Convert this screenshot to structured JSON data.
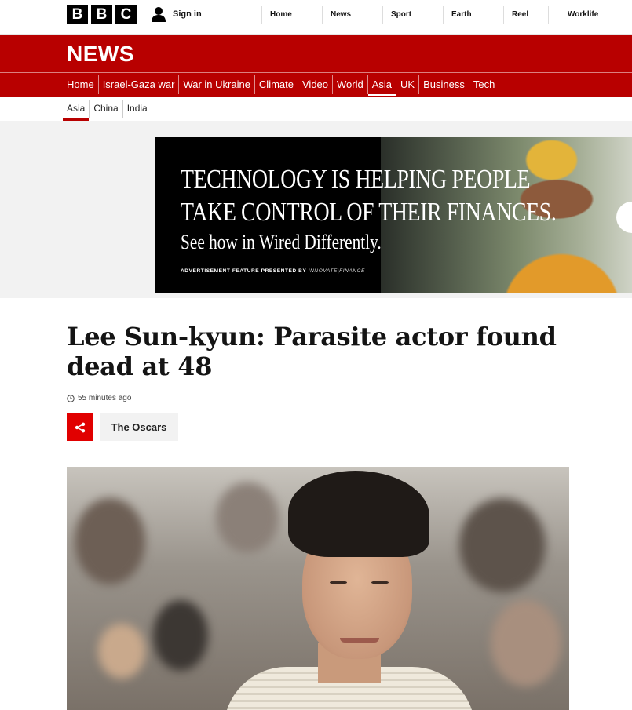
{
  "top_bar": {
    "logo_letters": [
      "B",
      "B",
      "C"
    ],
    "sign_in_label": "Sign in",
    "nav_items": [
      "Home",
      "News",
      "Sport",
      "Earth",
      "Reel",
      "Worklife"
    ]
  },
  "news_band": {
    "title": "NEWS",
    "nav_items": [
      "Home",
      "Israel-Gaza war",
      "War in Ukraine",
      "Climate",
      "Video",
      "World",
      "Asia",
      "UK",
      "Business",
      "Tech"
    ],
    "active_item": "Asia"
  },
  "sub_nav": {
    "items": [
      "Asia",
      "China",
      "India"
    ],
    "active_item": "Asia"
  },
  "advert": {
    "headline_line1": "TECHNOLOGY IS HELPING PEOPLE",
    "headline_line2": "TAKE CONTROL OF THEIR FINANCES.",
    "subline": "See how in Wired Differently.",
    "feature_label": "ADVERTISEMENT FEATURE PRESENTED BY",
    "feature_brand": "INNOVATE|FINANCE"
  },
  "article": {
    "headline": "Lee Sun-kyun: Parasite actor found dead at 48",
    "timestamp": "55 minutes ago",
    "topic_label": "The Oscars"
  },
  "icons": {
    "share": "share-icon",
    "clock": "clock-icon",
    "user": "user-icon"
  },
  "colors": {
    "brand_red": "#b80000",
    "share_red": "#e10000"
  }
}
